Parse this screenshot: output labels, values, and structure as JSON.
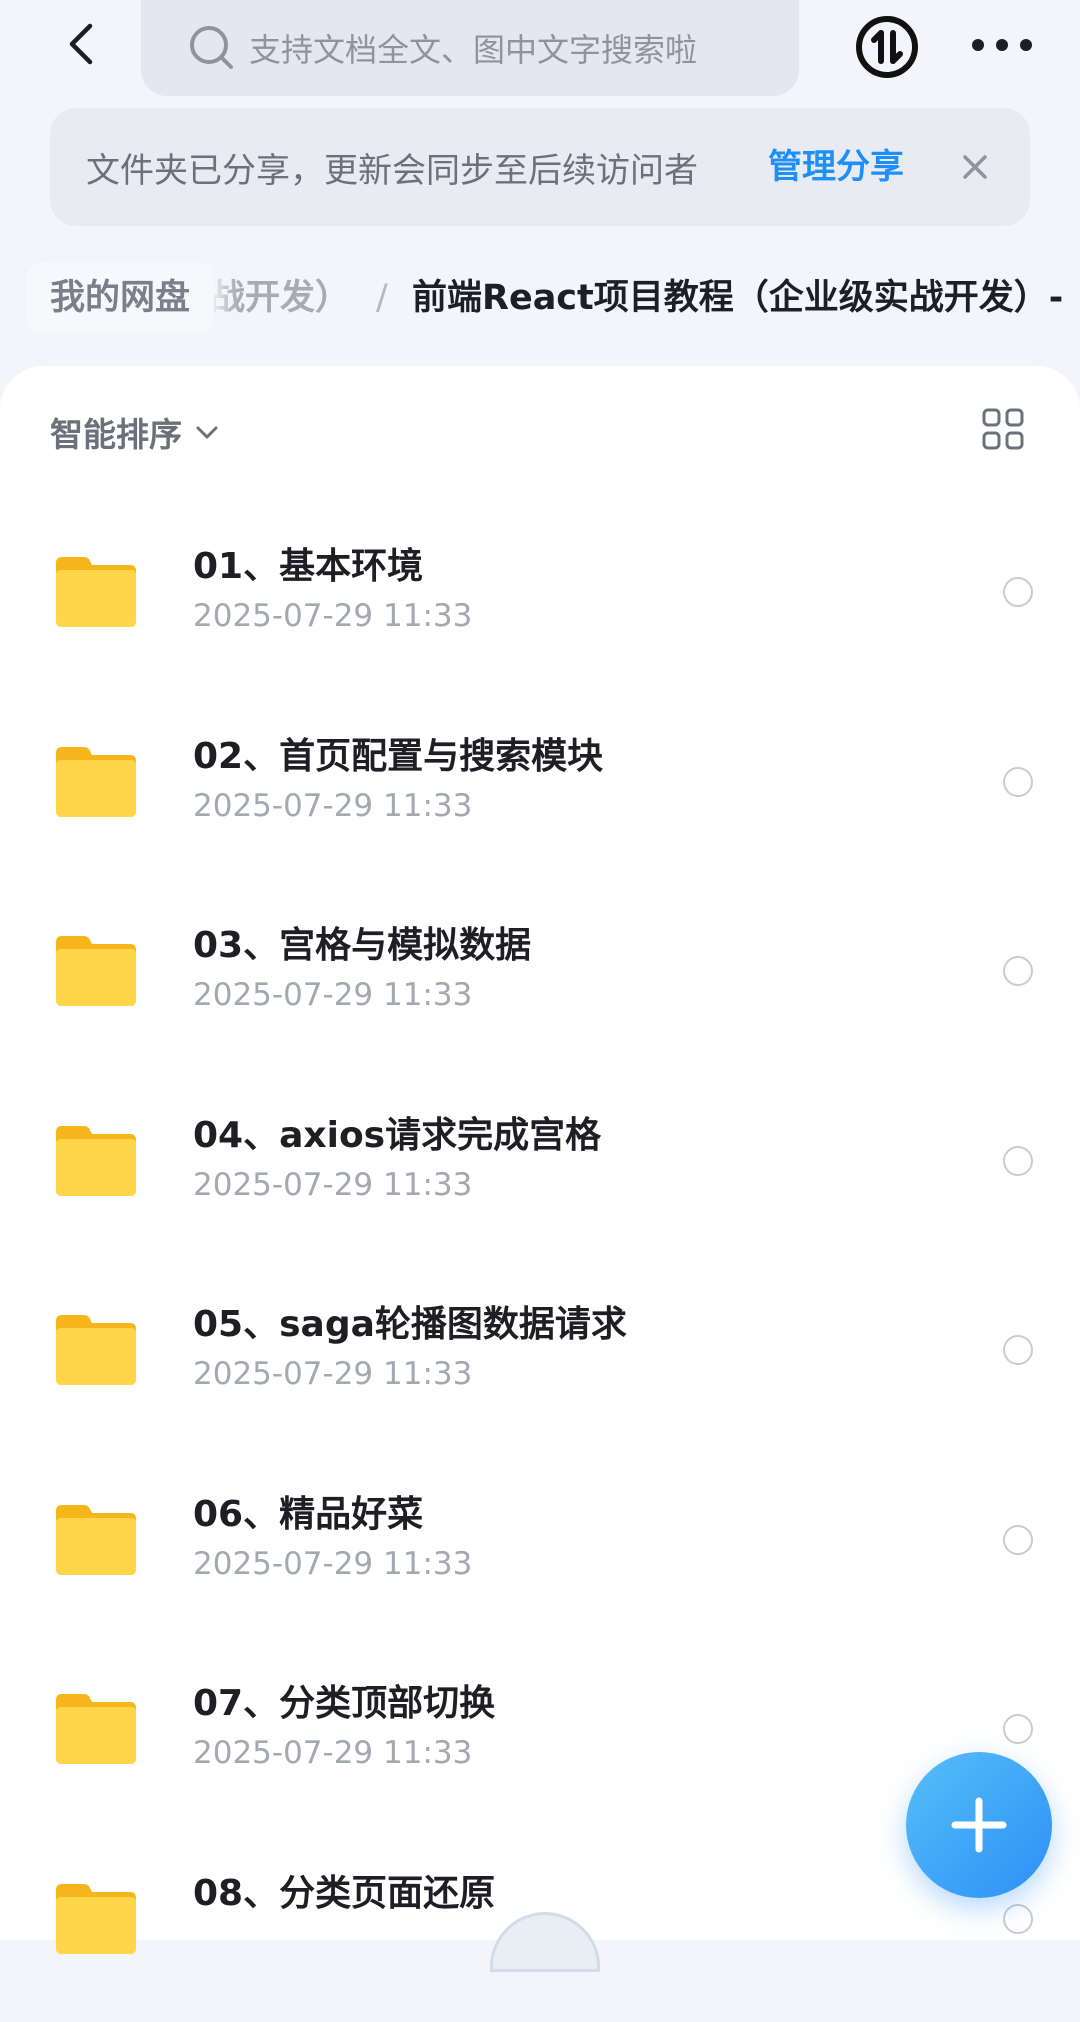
{
  "header": {
    "search_placeholder": "支持文档全文、图中文字搜索啦",
    "icons": {
      "back": "back-arrow-icon",
      "search": "search-icon",
      "transfer": "transfer-icon",
      "more": "more-dots-icon"
    }
  },
  "share_banner": {
    "message": "文件夹已分享，更新会同步至后续访问者",
    "action_label": "管理分享",
    "accent_color": "#1e8ff7"
  },
  "breadcrumb": {
    "root": "我的网盘",
    "partial": "战开发）",
    "separator": "/",
    "current": "前端React项目教程（企业级实战开发）-"
  },
  "toolbar": {
    "sort_label": "智能排序",
    "view_icon": "grid-view-icon"
  },
  "files": [
    {
      "name": "01、基本环境",
      "date": "2025-07-29 11:33"
    },
    {
      "name": "02、首页配置与搜索模块",
      "date": "2025-07-29 11:33"
    },
    {
      "name": "03、宫格与模拟数据",
      "date": "2025-07-29 11:33"
    },
    {
      "name": "04、axios请求完成宫格",
      "date": "2025-07-29 11:33"
    },
    {
      "name": "05、saga轮播图数据请求",
      "date": "2025-07-29 11:33"
    },
    {
      "name": "06、精品好菜",
      "date": "2025-07-29 11:33"
    },
    {
      "name": "07、分类顶部切换",
      "date": "2025-07-29 11:33"
    },
    {
      "name": "08、分类页面还原",
      "date": ""
    }
  ],
  "fab": {
    "icon": "plus-icon",
    "color": "#2d8ff5"
  }
}
